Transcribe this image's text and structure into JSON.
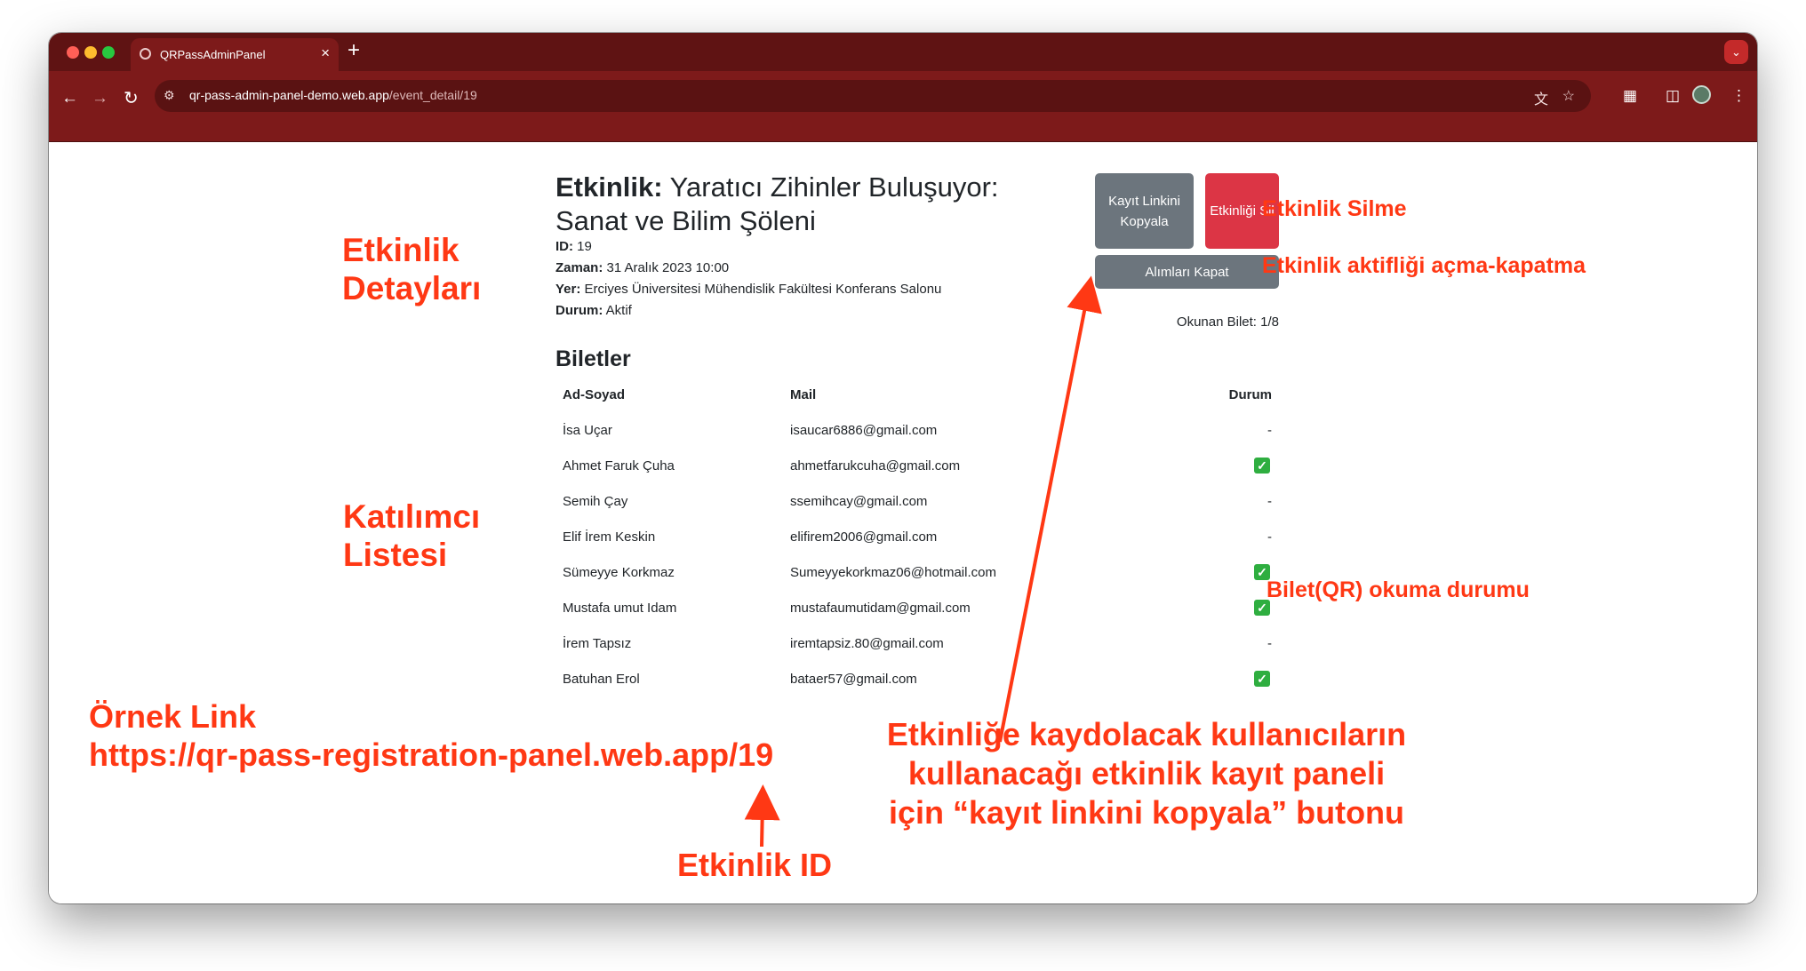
{
  "browser": {
    "tab_title": "QRPassAdminPanel",
    "tab_close": "×",
    "new_tab": "+",
    "url_host": "qr-pass-admin-panel-demo.web.app",
    "url_path": "/event_detail/19"
  },
  "event": {
    "title_label": "Etkinlik:",
    "title_text": "Yaratıcı Zihinler Buluşuyor: Sanat ve Bilim Şöleni",
    "id_label": "ID:",
    "id_value": "19",
    "time_label": "Zaman:",
    "time_value": "31 Aralık 2023 10:00",
    "place_label": "Yer:",
    "place_value": "Erciyes Üniversitesi Mühendislik Fakültesi Konferans Salonu",
    "status_label": "Durum:",
    "status_value": "Aktif"
  },
  "actions": {
    "copy_link_label": "Kayıt Linkini Kopyala",
    "delete_label": "Etkinliği Sil",
    "toggle_label": "Alımları Kapat",
    "read_count": "Okunan Bilet: 1/8"
  },
  "tickets": {
    "section_title": "Biletler",
    "columns": [
      "Ad-Soyad",
      "Mail",
      "Durum"
    ],
    "rows": [
      {
        "name": "İsa Uçar",
        "mail": "isaucar6886@gmail.com",
        "status": "-"
      },
      {
        "name": "Ahmet Faruk Çuha",
        "mail": "ahmetfarukcuha@gmail.com",
        "status": "✓"
      },
      {
        "name": "Semih Çay",
        "mail": "ssemihcay@gmail.com",
        "status": "-"
      },
      {
        "name": "Elif İrem Keskin",
        "mail": "elifirem2006@gmail.com",
        "status": "-"
      },
      {
        "name": "Sümeyye Korkmaz",
        "mail": "Sumeyyekorkmaz06@hotmail.com",
        "status": "✓"
      },
      {
        "name": "Mustafa umut Idam",
        "mail": "mustafaumutidam@gmail.com",
        "status": "✓"
      },
      {
        "name": "İrem Tapsız",
        "mail": "iremtapsiz.80@gmail.com",
        "status": "-"
      },
      {
        "name": "Batuhan Erol",
        "mail": "bataer57@gmail.com",
        "status": "✓"
      }
    ]
  },
  "annotations": {
    "details": "Etkinlik Detayları",
    "participants": "Katılımcı Listesi",
    "delete": "Etkinlik Silme",
    "toggle": "Etkinlik aktifliği açma-kapatma",
    "qr_status": "Bilet(QR) okuma durumu",
    "example_link_title": "Örnek Link",
    "example_link_url": "https://qr-pass-registration-panel.web.app/19",
    "event_id": "Etkinlik ID",
    "copy_button_note": "Etkinliğe kaydolacak kullanıcıların kullanacağı etkinlik kayıt paneli için “kayıt linkini kopyala” butonu"
  },
  "colors": {
    "annotation": "#ff3814",
    "delete_button": "#dc3545",
    "secondary_button": "#6c757d",
    "tab_bar": "#5f1313",
    "toolbar": "#7d1a1a",
    "check": "#2fae40"
  },
  "icons": [
    "back-icon",
    "forward-icon",
    "reload-icon",
    "site-info-icon",
    "translate-icon",
    "star-icon",
    "extensions-icon",
    "side-panel-icon",
    "menu-icon",
    "check-icon"
  ]
}
